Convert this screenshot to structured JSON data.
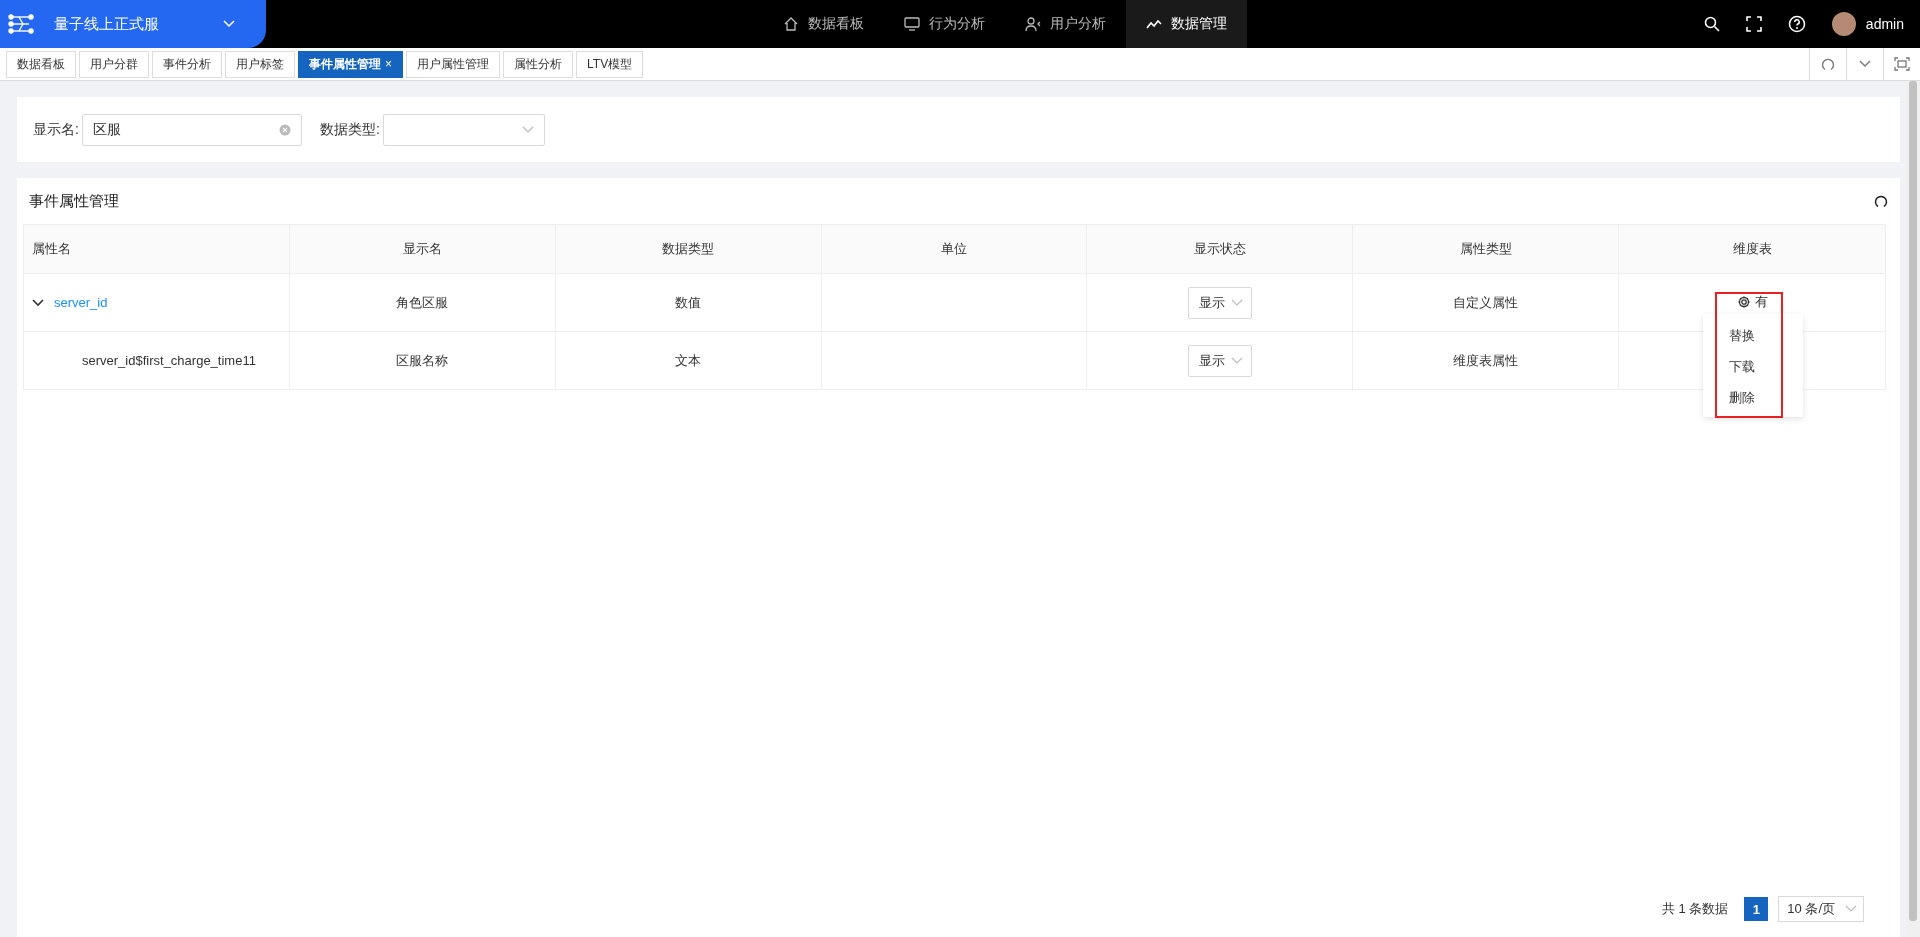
{
  "header": {
    "project": "量子线上正式服",
    "nav": [
      {
        "label": "数据看板",
        "selected": false
      },
      {
        "label": "行为分析",
        "selected": false
      },
      {
        "label": "用户分析",
        "selected": false
      },
      {
        "label": "数据管理",
        "selected": true
      }
    ],
    "user": "admin"
  },
  "tabs": [
    {
      "label": "数据看板",
      "selected": false
    },
    {
      "label": "用户分群",
      "selected": false
    },
    {
      "label": "事件分析",
      "selected": false
    },
    {
      "label": "用户标签",
      "selected": false
    },
    {
      "label": "事件属性管理",
      "selected": true,
      "close": "×"
    },
    {
      "label": "用户属性管理",
      "selected": false
    },
    {
      "label": "属性分析",
      "selected": false
    },
    {
      "label": "LTV模型",
      "selected": false
    }
  ],
  "filters": [
    {
      "kind": "text",
      "label": "显示名:",
      "value": "区服"
    },
    {
      "kind": "select",
      "label": "数据类型:"
    }
  ],
  "table": {
    "title": "事件属性管理",
    "columns": [
      "属性名",
      "显示名",
      "数据类型",
      "单位",
      "显示状态",
      "属性类型",
      "维度表"
    ],
    "rows": [
      {
        "name": "server_id",
        "display_name": "角色区服",
        "data_type": "数值",
        "status": "显示",
        "attribute_type": "自定义属性",
        "dimension": "有",
        "expanded": true,
        "menu": [
          "替换",
          "下载",
          "删除"
        ],
        "children": [
          {
            "name": "server_id$first_charge_time11",
            "display_name": "区服名称",
            "data_type": "文本",
            "status": "显示",
            "attribute_type": "维度表属性"
          }
        ]
      }
    ]
  },
  "pagination": {
    "total": "共 1 条数据",
    "pages": [
      {
        "label": "1",
        "selected": true
      }
    ],
    "page_size": "10 条/页"
  }
}
